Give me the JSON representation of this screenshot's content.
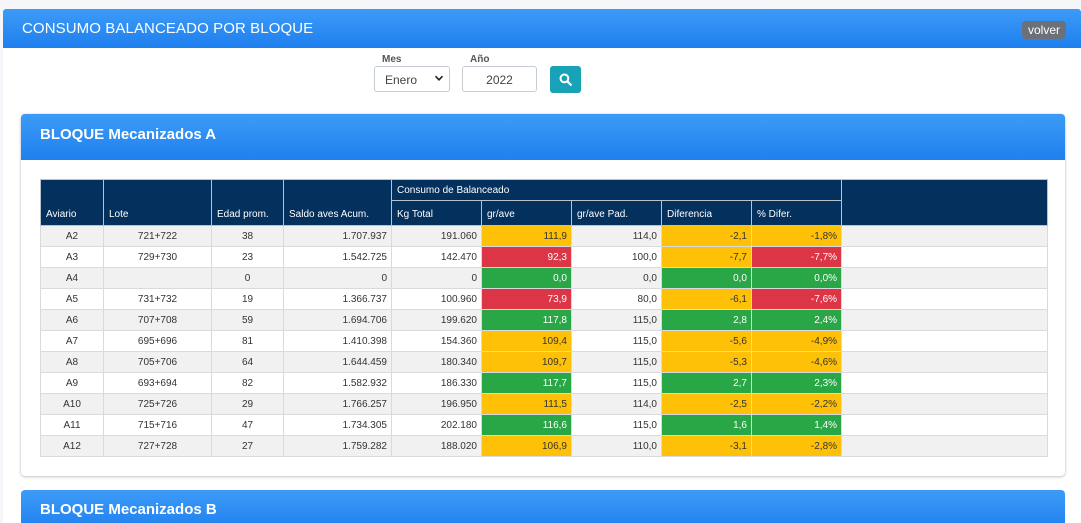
{
  "page": {
    "title": "CONSUMO BALANCEADO POR BLOQUE",
    "back_label": "volver"
  },
  "filters": {
    "mes_label": "Mes",
    "mes_value": "Enero",
    "anio_label": "Año",
    "anio_value": "2022",
    "search_icon": "search-icon"
  },
  "colors": {
    "yellow": "#fec107",
    "red": "#dc3546",
    "green": "#29a646",
    "header": "#03305c",
    "accent": "#2a8af3"
  },
  "blocks": [
    {
      "title": "BLOQUE Mecanizados A",
      "table": {
        "headers": {
          "aviario": "Aviario",
          "lote": "Lote",
          "edad": "Edad prom.",
          "saldo": "Saldo aves Acum.",
          "group": "Consumo de Balanceado",
          "kg_total": "Kg Total",
          "gr_ave": "gr/ave",
          "gr_ave_pad": "gr/ave Pad.",
          "diferencia": "Diferencia",
          "pct_difer": "% Difer."
        },
        "rows": [
          {
            "aviario": "A2",
            "lote": "721+722",
            "edad": "38",
            "saldo": "1.707.937",
            "kg_total": "191.060",
            "gr_ave": "111,9",
            "gr_ave_status": "yellow",
            "gr_ave_pad": "114,0",
            "diferencia": "-2,1",
            "diferencia_status": "yellow",
            "pct_difer": "-1,8%",
            "pct_difer_status": "yellow"
          },
          {
            "aviario": "A3",
            "lote": "729+730",
            "edad": "23",
            "saldo": "1.542.725",
            "kg_total": "142.470",
            "gr_ave": "92,3",
            "gr_ave_status": "red",
            "gr_ave_pad": "100,0",
            "diferencia": "-7,7",
            "diferencia_status": "yellow",
            "pct_difer": "-7,7%",
            "pct_difer_status": "red"
          },
          {
            "aviario": "A4",
            "lote": "",
            "edad": "0",
            "saldo": "0",
            "kg_total": "0",
            "gr_ave": "0,0",
            "gr_ave_status": "green",
            "gr_ave_pad": "0,0",
            "diferencia": "0,0",
            "diferencia_status": "green",
            "pct_difer": "0,0%",
            "pct_difer_status": "green"
          },
          {
            "aviario": "A5",
            "lote": "731+732",
            "edad": "19",
            "saldo": "1.366.737",
            "kg_total": "100.960",
            "gr_ave": "73,9",
            "gr_ave_status": "red",
            "gr_ave_pad": "80,0",
            "diferencia": "-6,1",
            "diferencia_status": "yellow",
            "pct_difer": "-7,6%",
            "pct_difer_status": "red"
          },
          {
            "aviario": "A6",
            "lote": "707+708",
            "edad": "59",
            "saldo": "1.694.706",
            "kg_total": "199.620",
            "gr_ave": "117,8",
            "gr_ave_status": "green",
            "gr_ave_pad": "115,0",
            "diferencia": "2,8",
            "diferencia_status": "green",
            "pct_difer": "2,4%",
            "pct_difer_status": "green"
          },
          {
            "aviario": "A7",
            "lote": "695+696",
            "edad": "81",
            "saldo": "1.410.398",
            "kg_total": "154.360",
            "gr_ave": "109,4",
            "gr_ave_status": "yellow",
            "gr_ave_pad": "115,0",
            "diferencia": "-5,6",
            "diferencia_status": "yellow",
            "pct_difer": "-4,9%",
            "pct_difer_status": "yellow"
          },
          {
            "aviario": "A8",
            "lote": "705+706",
            "edad": "64",
            "saldo": "1.644.459",
            "kg_total": "180.340",
            "gr_ave": "109,7",
            "gr_ave_status": "yellow",
            "gr_ave_pad": "115,0",
            "diferencia": "-5,3",
            "diferencia_status": "yellow",
            "pct_difer": "-4,6%",
            "pct_difer_status": "yellow"
          },
          {
            "aviario": "A9",
            "lote": "693+694",
            "edad": "82",
            "saldo": "1.582.932",
            "kg_total": "186.330",
            "gr_ave": "117,7",
            "gr_ave_status": "green",
            "gr_ave_pad": "115,0",
            "diferencia": "2,7",
            "diferencia_status": "green",
            "pct_difer": "2,3%",
            "pct_difer_status": "green"
          },
          {
            "aviario": "A10",
            "lote": "725+726",
            "edad": "29",
            "saldo": "1.766.257",
            "kg_total": "196.950",
            "gr_ave": "111,5",
            "gr_ave_status": "yellow",
            "gr_ave_pad": "114,0",
            "diferencia": "-2,5",
            "diferencia_status": "yellow",
            "pct_difer": "-2,2%",
            "pct_difer_status": "yellow"
          },
          {
            "aviario": "A11",
            "lote": "715+716",
            "edad": "47",
            "saldo": "1.734.305",
            "kg_total": "202.180",
            "gr_ave": "116,6",
            "gr_ave_status": "green",
            "gr_ave_pad": "115,0",
            "diferencia": "1,6",
            "diferencia_status": "green",
            "pct_difer": "1,4%",
            "pct_difer_status": "green"
          },
          {
            "aviario": "A12",
            "lote": "727+728",
            "edad": "27",
            "saldo": "1.759.282",
            "kg_total": "188.020",
            "gr_ave": "106,9",
            "gr_ave_status": "yellow",
            "gr_ave_pad": "110,0",
            "diferencia": "-3,1",
            "diferencia_status": "yellow",
            "pct_difer": "-2,8%",
            "pct_difer_status": "yellow"
          }
        ]
      }
    },
    {
      "title": "BLOQUE Mecanizados B"
    }
  ]
}
